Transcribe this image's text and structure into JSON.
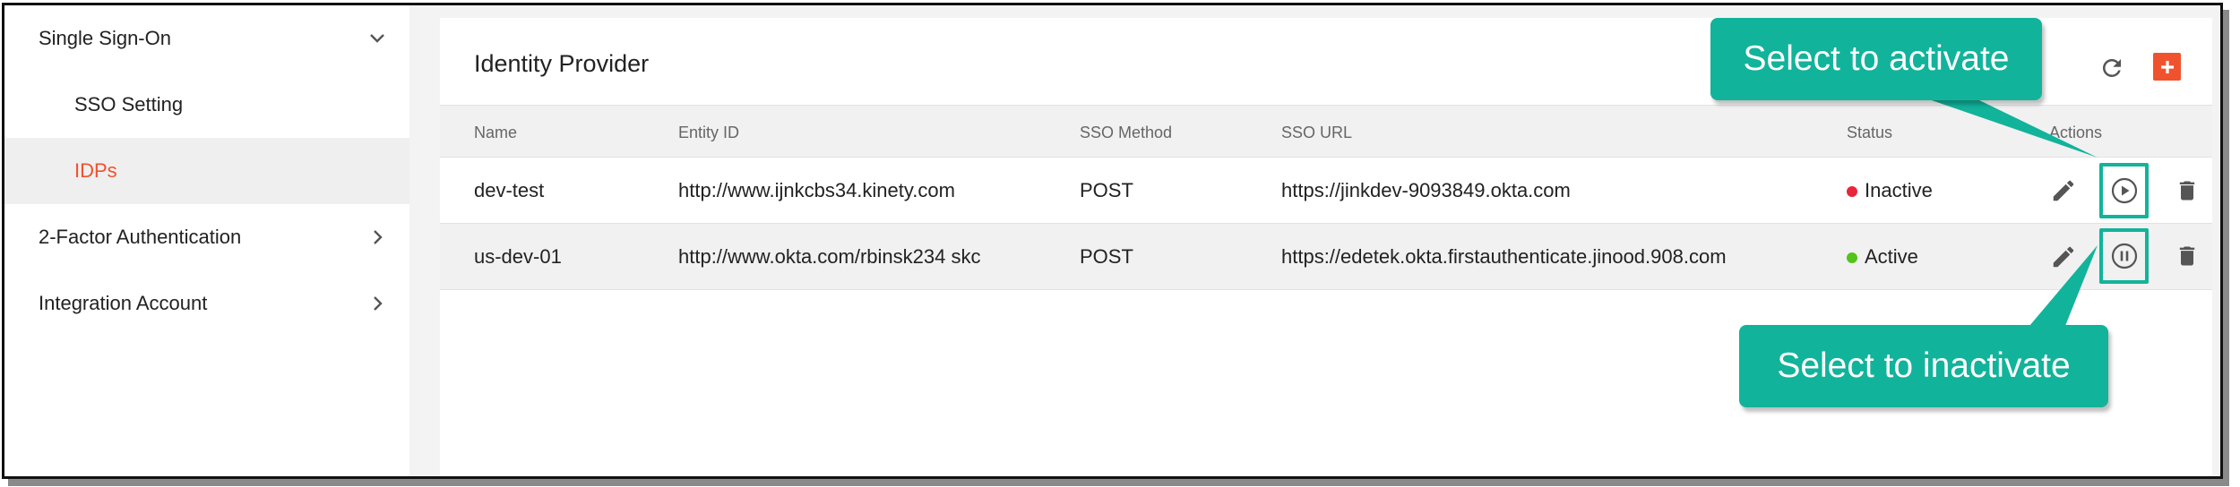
{
  "sidebar": {
    "items": [
      {
        "label": "Single Sign-On",
        "chevron": "chevron-down-icon"
      },
      {
        "label": "SSO Setting"
      },
      {
        "label": "IDPs",
        "selected": true
      },
      {
        "label": "2-Factor Authentication",
        "chevron": "chevron-right-icon"
      },
      {
        "label": "Integration Account",
        "chevron": "chevron-right-icon"
      }
    ]
  },
  "panel": {
    "title": "Identity Provider",
    "toolbar": {
      "refresh_icon": "refresh-icon",
      "add_icon": "plus-icon"
    },
    "columns": [
      "Name",
      "Entity ID",
      "SSO Method",
      "SSO URL",
      "Status",
      "Actions"
    ],
    "rows": [
      {
        "name": "dev-test",
        "entity_id": "http://www.ijnkcbs34.kinety.com",
        "method": "POST",
        "url": "https://jinkdev-9093849.okta.com",
        "status": "Inactive",
        "status_color": "#e8253a",
        "toggle_icon": "play-icon"
      },
      {
        "name": "us-dev-01",
        "entity_id": "http://www.okta.com/rbinsk234 skc",
        "method": "POST",
        "url": "https://edetek.okta.firstauthenticate.jinood.908.com",
        "status": "Active",
        "status_color": "#52c41a",
        "toggle_icon": "pause-icon"
      }
    ]
  },
  "callouts": {
    "activate": "Select to activate",
    "inactivate": "Select to inactivate"
  },
  "colors": {
    "accent": "#f0522e",
    "callout": "#12b39b"
  }
}
